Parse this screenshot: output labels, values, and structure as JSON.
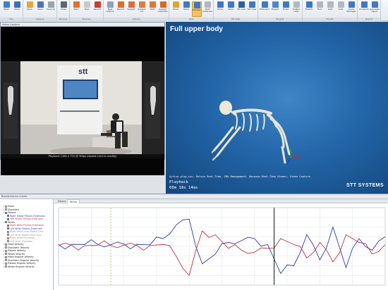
{
  "toolbar": {
    "groups": [
      {
        "caption": "File",
        "buttons": [
          {
            "label": "Open",
            "icon": "open-folder-icon",
            "color": "#3f7fcb"
          },
          {
            "label": "Save",
            "icon": "save-disk-icon",
            "color": "#3e6fb5"
          }
        ]
      },
      {
        "caption": "Capture",
        "buttons": [
          {
            "label": "Open",
            "icon": "open-folder-icon",
            "color": "#e2a83a"
          },
          {
            "label": "Save",
            "icon": "save-disk-icon",
            "color": "#4c74b3"
          },
          {
            "label": "Save as",
            "icon": "save-as-icon",
            "color": "#9aa4ae"
          }
        ]
      },
      {
        "caption": "Window",
        "buttons": [
          {
            "label": "Close",
            "icon": "close-icon",
            "color": "#5a6874"
          }
        ]
      },
      {
        "caption": "Devices",
        "buttons": [
          {
            "label": "Start",
            "icon": "play-icon",
            "color": "#e0712b"
          },
          {
            "label": "Stop",
            "icon": "stop-icon",
            "color": "#c9c9c9"
          },
          {
            "label": "Record",
            "icon": "record-icon",
            "color": "#d03a2a"
          }
        ]
      },
      {
        "caption": "Actions",
        "buttons": [
          {
            "label": "New capture",
            "icon": "new-capture-icon",
            "color": "#8ea2b8"
          },
          {
            "label": "Record",
            "icon": "record-icon",
            "color": "#e86a2a"
          },
          {
            "label": "Subject",
            "icon": "subject-icon",
            "color": "#de6a3c"
          },
          {
            "label": "Subject cal.",
            "icon": "calibration-icon",
            "color": "#df7d3c"
          },
          {
            "label": "Shift",
            "icon": "shift-icon",
            "color": "#e27630"
          },
          {
            "label": "Subject calibration",
            "icon": "subject-calibration-icon",
            "color": "#d9682c"
          }
        ]
      },
      {
        "caption": "View",
        "buttons": [
          {
            "label": "Show",
            "icon": "monitor-icon",
            "color": "#e3a62c"
          },
          {
            "label": "Skins",
            "icon": "skins-icon",
            "color": "#3e78c6"
          },
          {
            "label": "Dashboard",
            "icon": "dashboard-icon",
            "color": "#3e78c6",
            "active": true
          },
          {
            "label": "Shift Calibration",
            "icon": "shift-calibration-icon",
            "color": "#b0b8c2"
          }
        ]
      },
      {
        "caption": "3D View",
        "buttons": [
          {
            "label": "Show",
            "icon": "monitor-icon",
            "color": "#3e78c6"
          },
          {
            "label": "Skins",
            "icon": "skins-icon",
            "color": "#3e78c6"
          },
          {
            "label": "3D view",
            "icon": "3d-view-icon",
            "color": "#2d5fa8"
          },
          {
            "label": "Set view",
            "icon": "set-view-icon",
            "color": "#3e78c6"
          }
        ]
      },
      {
        "caption": "Plugins",
        "buttons": [
          {
            "label": "Extensions",
            "icon": "extensions-icon",
            "color": "#3e78c6"
          },
          {
            "label": "Plugins",
            "icon": "plugins-icon",
            "color": "#4a86cf"
          },
          {
            "label": "Rules",
            "icon": "rules-icon",
            "color": "#3e78c6"
          },
          {
            "label": "Enable rules",
            "icon": "enable-rules-icon",
            "color": "#b0b8c2"
          }
        ]
      },
      {
        "caption": "Events",
        "buttons": [
          {
            "label": "Events",
            "icon": "events-icon",
            "color": "#3e78c6"
          },
          {
            "label": "Find",
            "icon": "find-icon",
            "color": "#b0b8c2"
          },
          {
            "label": "Gait",
            "icon": "gait-icon",
            "color": "#b0b8c2"
          },
          {
            "label": "Auto",
            "icon": "auto-icon",
            "color": "#b0b8c2"
          },
          {
            "label": "Cycle Manager",
            "icon": "cycle-manager-icon",
            "color": "#3e78c6"
          }
        ]
      },
      {
        "caption": "Report",
        "buttons": [
          {
            "label": "Screenshots",
            "icon": "screenshot-icon",
            "color": "#3e78c6"
          },
          {
            "label": "Generate report",
            "icon": "report-icon",
            "color": "#3e78c6"
          }
        ]
      }
    ]
  },
  "video": {
    "header": "Video Capture",
    "status": "Playback 1280 x 720 @ 30fps (double click to modify)"
  },
  "view3d": {
    "title": "Full upper body",
    "plugins": "Active plug-ins: Delsys Real-Time, IMU Management, Noraxon Real-Time Viewer, Video Capture",
    "mode": "Playback",
    "time": "00m 18s 14ms",
    "brand": "STT SYSTEMS"
  },
  "graph": {
    "header": "Biomechanics charts",
    "tabs": [
      "Elbows",
      "Wrists"
    ],
    "tree": [
      {
        "label": "Head",
        "level": "top",
        "checked": false
      },
      {
        "label": "Shoulders",
        "level": "top",
        "checked": false
      },
      {
        "label": "Elbows",
        "level": "top",
        "checked": true
      },
      {
        "label": "Right Elbow Flexion-Extension",
        "level": "sub",
        "checked": true
      },
      {
        "label": "Left Elbow Flexion-Extension",
        "level": "sub",
        "checked": true
      },
      {
        "label": "Wrists",
        "level": "top",
        "checked": true
      },
      {
        "label": "Right Wrist Flexion-Extension",
        "level": "sub",
        "checked": true
      },
      {
        "label": "Left Wrist Flexion-Extension",
        "level": "sub",
        "checked": true
      },
      {
        "label": "Right Wrist Ulnar-Radial Dev.",
        "level": "sub",
        "checked": false
      },
      {
        "label": "Left Wrist Radial-Ulnar Dev.",
        "level": "sub",
        "checked": false
      },
      {
        "label": "Right Wrist Pronation",
        "level": "sub",
        "checked": false
      },
      {
        "label": "Left Wrist Pronation",
        "level": "sub",
        "checked": false
      },
      {
        "label": "Head Velocity",
        "level": "top",
        "checked": false
      },
      {
        "label": "Shoulders Velocity",
        "level": "top",
        "checked": false
      },
      {
        "label": "Elbows Velocity",
        "level": "top",
        "checked": false
      },
      {
        "label": "Wrists Velocity",
        "level": "top",
        "checked": false
      },
      {
        "label": "Head Angular Velocity",
        "level": "top",
        "checked": false
      },
      {
        "label": "Shoulders Angular Velocity",
        "level": "top",
        "checked": false
      },
      {
        "label": "Elbows Angular Velocity",
        "level": "top",
        "checked": false
      },
      {
        "label": "Wrists Angular Velocity",
        "level": "top",
        "checked": false
      }
    ]
  },
  "chart_data": {
    "type": "line",
    "x": [
      0,
      4,
      8,
      12,
      16,
      20,
      24,
      28,
      32,
      36,
      40,
      44,
      48,
      52,
      56,
      60,
      64,
      68,
      72,
      76,
      80,
      84,
      88,
      92,
      96,
      100
    ],
    "series": [
      {
        "color": "#2b3aa8",
        "values": [
          0.05,
          0.05,
          0.05,
          0.05,
          0.04,
          0.06,
          0.05,
          0.04,
          0.2,
          0.55,
          0.7,
          -0.45,
          -0.2,
          0.1,
          0.15,
          0.2,
          0.05,
          -0.7,
          -0.5,
          0.3,
          -0.35,
          0.5,
          -0.55,
          0.2,
          -0.1,
          0.25
        ]
      },
      {
        "color": "#c0303a",
        "values": [
          0.02,
          0.03,
          0.02,
          0.03,
          0.02,
          0.03,
          0.02,
          0.02,
          0.05,
          -0.25,
          -0.75,
          0.4,
          0.3,
          -0.05,
          -0.1,
          -0.15,
          -0.05,
          0.2,
          0.05,
          -0.3,
          0.1,
          -0.4,
          0.3,
          0.1,
          -0.2,
          0.05
        ]
      }
    ],
    "ylim": [
      -1,
      1
    ],
    "cursor_x": 66,
    "marker_x": 16,
    "grid": true
  }
}
